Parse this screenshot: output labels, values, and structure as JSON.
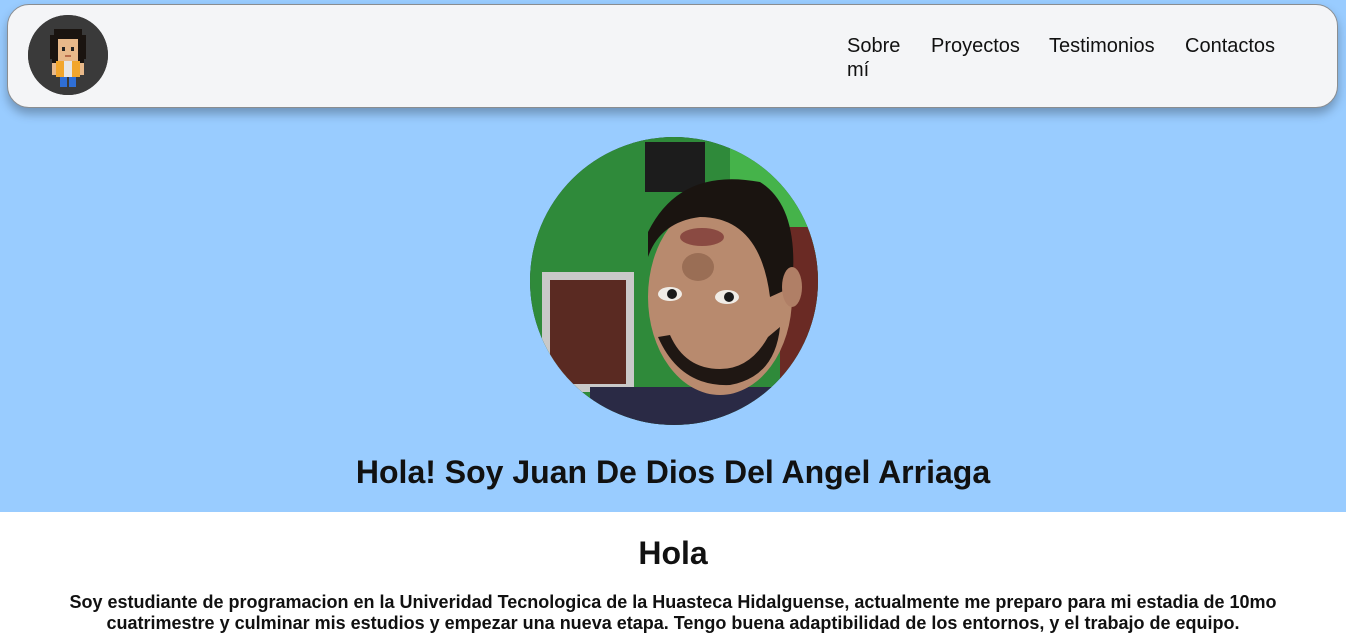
{
  "nav": {
    "logo_icon": "pixel-avatar-icon",
    "links": [
      {
        "label": "Sobre mí"
      },
      {
        "label": "Proyectos"
      },
      {
        "label": "Testimonios"
      },
      {
        "label": "Contactos"
      }
    ]
  },
  "hero": {
    "photo_icon": "profile-photo",
    "title": "Hola! Soy Juan De Dios Del Angel Arriaga"
  },
  "about": {
    "heading": "Hola",
    "text": "Soy estudiante de programacion en la Univeridad Tecnologica de la Huasteca Hidalguense, actualmente me preparo para mi estadia de 10mo cuatrimestre y culminar mis estudios y empezar una nueva etapa. Tengo buena adaptibilidad de los entornos, y el trabajo de equipo."
  },
  "colors": {
    "hero_background": "#99ccff",
    "navbar_background": "#f4f5f7",
    "page_background": "#ffffff"
  }
}
